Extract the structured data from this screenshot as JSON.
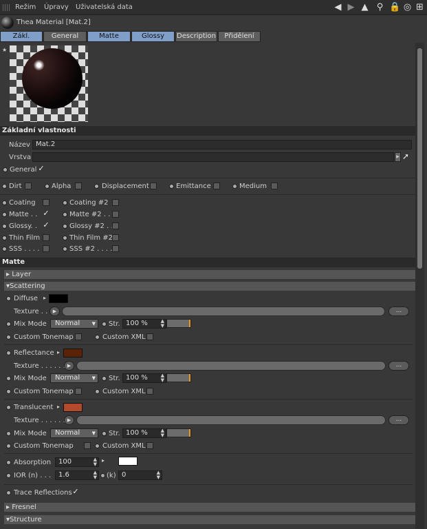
{
  "menu": {
    "items": [
      "Režim",
      "Úpravy",
      "Uživatelská data"
    ]
  },
  "window": {
    "title": "Thea Material [Mat.2]"
  },
  "tabs": [
    "Zákl.",
    "General",
    "Matte",
    "Glossy",
    "Description",
    "Přidělení"
  ],
  "basic": {
    "header": "Základní vlastnosti",
    "name_label": "Název",
    "name_value": "Mat.2",
    "layer_label": "Vrstva",
    "general_label": "General"
  },
  "layers_row1": [
    "Dirt",
    "Alpha",
    "Displacement",
    "Emittance",
    "Medium"
  ],
  "layers_col1": [
    "Coating",
    "Matte . .",
    "Glossy. .",
    "Thin Film",
    "SSS . . . ."
  ],
  "layers_col2": [
    "Coating #2",
    "Matte #2 . .",
    "Glossy #2 . .",
    "Thin Film #2",
    "SSS #2 . . . ."
  ],
  "matte": {
    "header": "Matte",
    "layer_label": "Layer",
    "scattering_label": "Scattering"
  },
  "diffuse": {
    "label": "Diffuse",
    "texture_label": "Texture . .",
    "mix_label": "Mix Mode",
    "mix_value": "Normal",
    "str_label": "Str.",
    "str_value": "100 %",
    "tonemap_label": "Custom Tonemap",
    "xml_label": "Custom XML"
  },
  "reflectance": {
    "label": "Reflectance",
    "texture_label": "Texture . . . . . .",
    "mix_label": "Mix Mode",
    "mix_value": "Normal",
    "str_label": "Str.",
    "str_value": "100 %",
    "tonemap_label": "Custom Tonemap",
    "xml_label": "Custom XML"
  },
  "translucent": {
    "label": "Translucent",
    "texture_label": "Texture . . . . . .",
    "mix_label": "Mix Mode",
    "mix_value": "Normal",
    "str_label": "Str.",
    "str_value": "100 %",
    "tonemap_label": "Custom Tonemap",
    "xml_label": "Custom XML"
  },
  "absorption": {
    "label": "Absorption",
    "value": "100"
  },
  "ior": {
    "label": "IOR (n) . . .",
    "value": "1.6",
    "k_label": "(k)",
    "k_value": "0"
  },
  "trace": {
    "label": "Trace Reflections"
  },
  "fresnel_label": "Fresnel",
  "structure_label": "Structure",
  "browse_label": "...",
  "colors": {
    "diffuse": "#000000",
    "reflectance": "#5a2206",
    "translucent": "#b44a2c",
    "absorption": "#ffffff",
    "tab_active": "#7f9ec8"
  }
}
